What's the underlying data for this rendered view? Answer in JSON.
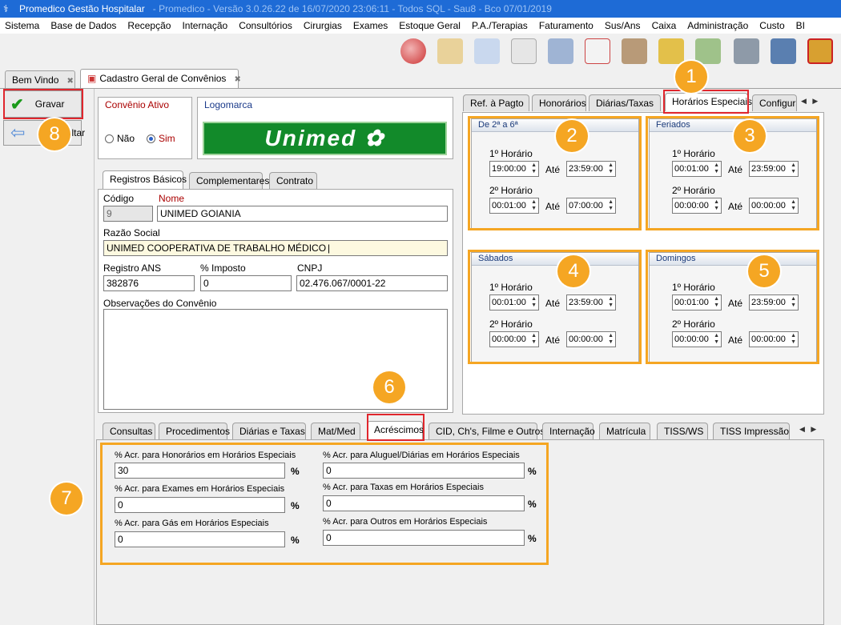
{
  "window": {
    "title": "Promedico Gestão Hospitalar",
    "subtitle": "- Promedico - Versão 3.0.26.22 de 16/07/2020 23:06:11 - Todos SQL - Sau8 - Bco 07/01/2019"
  },
  "menu": [
    "Sistema",
    "Base de Dados",
    "Recepção",
    "Internação",
    "Consultórios",
    "Cirurgias",
    "Exames",
    "Estoque Geral",
    "P.A./Terapias",
    "Faturamento",
    "Sus/Ans",
    "Caixa",
    "Administração",
    "Custo",
    "BI"
  ],
  "doc_tabs": [
    {
      "label": "Bem Vindo"
    },
    {
      "label": "Cadastro Geral de Convênios"
    }
  ],
  "actions": {
    "save": "Gravar",
    "back": "Voltar"
  },
  "convenio_ativo": {
    "title": "Convênio Ativo",
    "no": "Não",
    "yes": "Sim",
    "selected": "Sim"
  },
  "logomarca": {
    "title": "Logomarca",
    "logo_text": "Unimed"
  },
  "form_tabs": [
    "Registros Básicos",
    "Complementares",
    "Contrato"
  ],
  "form": {
    "codigo_label": "Código",
    "codigo": "9",
    "nome_label": "Nome",
    "nome": "UNIMED GOIANIA",
    "razao_label": "Razão Social",
    "razao": "UNIMED COOPERATIVA DE TRABALHO MÉDICO",
    "ans_label": "Registro ANS",
    "ans": "382876",
    "imposto_label": "% Imposto",
    "imposto": "0",
    "cnpj_label": "CNPJ",
    "cnpj": "02.476.067/0001-22",
    "obs_label": "Observações do Convênio"
  },
  "right_tabs": [
    "Ref. à Pagto",
    "Honorários",
    "Diárias/Taxas",
    "Horários Especiais",
    "Configura"
  ],
  "horarios": {
    "h1": "1º Horário",
    "h2": "2º Horário",
    "ate": "Até",
    "boxes": [
      {
        "title": "De 2ª a 6ª",
        "h1_from": "19:00:00",
        "h1_to": "23:59:00",
        "h2_from": "00:01:00",
        "h2_to": "07:00:00"
      },
      {
        "title": "Feriados",
        "h1_from": "00:01:00",
        "h1_to": "23:59:00",
        "h2_from": "00:00:00",
        "h2_to": "00:00:00"
      },
      {
        "title": "Sábados",
        "h1_from": "00:01:00",
        "h1_to": "23:59:00",
        "h2_from": "00:00:00",
        "h2_to": "00:00:00"
      },
      {
        "title": "Domingos",
        "h1_from": "00:01:00",
        "h1_to": "23:59:00",
        "h2_from": "00:00:00",
        "h2_to": "00:00:00"
      }
    ]
  },
  "bottom_tabs": [
    "Consultas",
    "Procedimentos",
    "Diárias e Taxas",
    "Mat/Med",
    "Acréscimos",
    "CID, Ch's, Filme e Outros",
    "Internação",
    "Matrícula",
    "TISS/WS",
    "TISS Impressão"
  ],
  "acrescimos": {
    "pct_symbol": "%",
    "fields": [
      {
        "label": "% Acr. para Honorários em Horários Especiais",
        "value": "30"
      },
      {
        "label": "% Acr. para Exames em Horários Especiais",
        "value": "0"
      },
      {
        "label": "% Acr. para Gás em Horários Especiais",
        "value": "0"
      },
      {
        "label": "% Acr. para Aluguel/Diárias em Horários Especiais",
        "value": "0"
      },
      {
        "label": "% Acr. para Taxas em Horários Especiais",
        "value": "0"
      },
      {
        "label": "% Acr. para Outros em Horários Especiais",
        "value": "0"
      }
    ]
  },
  "callouts": [
    "1",
    "2",
    "3",
    "4",
    "5",
    "6",
    "7",
    "8"
  ]
}
